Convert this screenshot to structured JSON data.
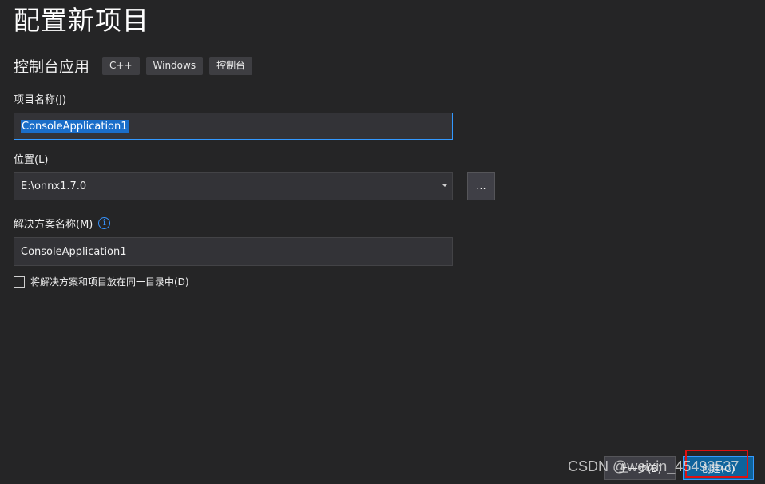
{
  "page_title": "配置新项目",
  "template": {
    "name": "控制台应用",
    "tags": [
      "C++",
      "Windows",
      "控制台"
    ]
  },
  "project_name": {
    "label": "项目名称(J)",
    "value": "ConsoleApplication1"
  },
  "location": {
    "label": "位置(L)",
    "value": "E:\\onnx1.7.0",
    "browse_label": "..."
  },
  "solution_name": {
    "label": "解决方案名称(M)",
    "info_icon": "info-icon",
    "value": "ConsoleApplication1"
  },
  "same_directory": {
    "label": "将解决方案和项目放在同一目录中(D)",
    "checked": false
  },
  "footer": {
    "back_label": "上一步(B)",
    "create_label": "创建(C)"
  },
  "watermark": "CSDN @weixin_45493537",
  "colors": {
    "background": "#252526",
    "input_bg": "#333337",
    "focus_border": "#3399ff",
    "selection": "#1a6ec9",
    "primary_button": "#0e639c",
    "highlight_box": "#e01010"
  }
}
